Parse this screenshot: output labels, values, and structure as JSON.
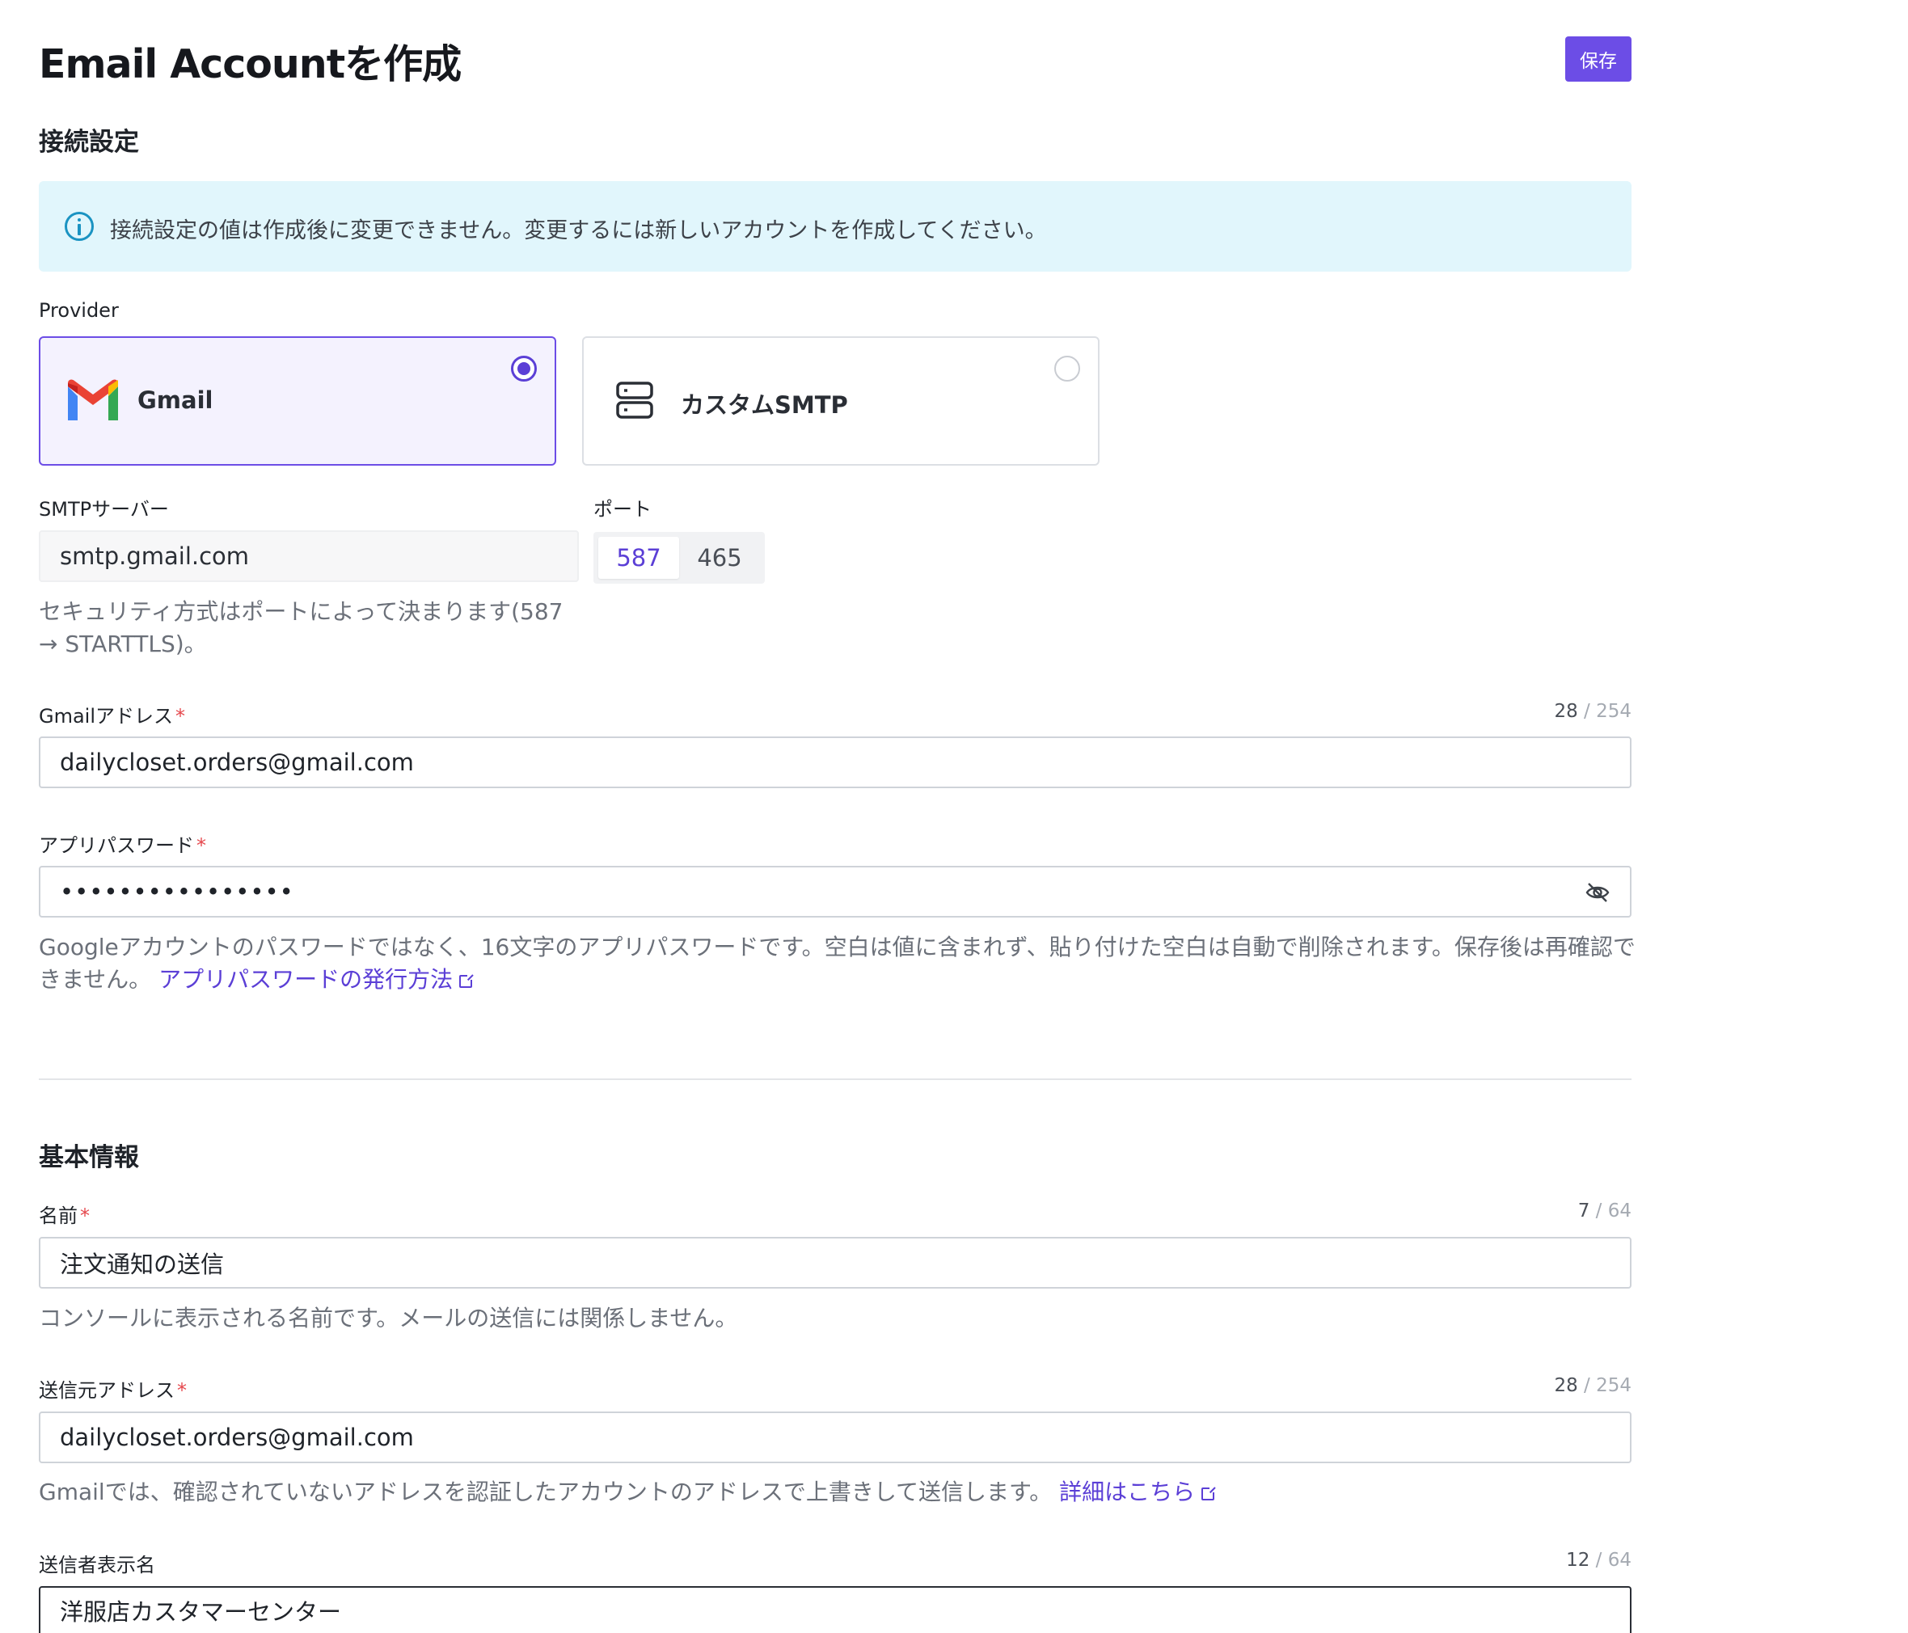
{
  "page": {
    "title": "Email Accountを作成",
    "save_label": "保存"
  },
  "connection": {
    "section_title": "接続設定",
    "info_text": "接続設定の値は作成後に変更できません。変更するには新しいアカウントを作成してください。",
    "provider_label": "Provider",
    "providers": [
      {
        "label": "Gmail",
        "selected": true
      },
      {
        "label": "カスタムSMTP",
        "selected": false
      }
    ],
    "smtp_server_label": "SMTPサーバー",
    "smtp_server_value": "smtp.gmail.com",
    "port_label": "ポート",
    "port_options": [
      "587",
      "465"
    ],
    "port_selected": "587",
    "security_help_line1": "セキュリティ方式はポートによって決まります(587",
    "security_help_line2": "→ STARTTLS)。",
    "gmail_address_label": "Gmailアドレス",
    "gmail_address_value": "dailycloset.orders@gmail.com",
    "gmail_address_count": "28",
    "gmail_address_max": "/ 254",
    "app_password_label": "アプリパスワード",
    "app_password_masked": "••••••••••••••••",
    "app_password_help_line1": "Googleアカウントのパスワードではなく、16文字のアプリパスワードです。空白は値に含まれず、貼り付けた空白は自動で削除されます。保存後は再確認で",
    "app_password_help_line2": "きません。",
    "app_password_link": "アプリパスワードの発行方法",
    "required_mark": "*"
  },
  "basic": {
    "section_title": "基本情報",
    "name_label": "名前",
    "name_value": "注文通知の送信",
    "name_count": "7",
    "name_max": "/ 64",
    "name_help": "コンソールに表示される名前です。メールの送信には関係しません。",
    "from_label": "送信元アドレス",
    "from_value": "dailycloset.orders@gmail.com",
    "from_count": "28",
    "from_max": "/ 254",
    "from_help": "Gmailでは、確認されていないアドレスを認証したアカウントのアドレスで上書きして送信します。",
    "from_link": "詳細はこちら",
    "sender_label": "送信者表示名",
    "sender_value": "洋服店カスタマーセンター",
    "sender_count": "12",
    "sender_max": "/ 64"
  },
  "colors": {
    "accent": "#6c4de6",
    "info_bg": "#e1f6fc",
    "info_icon": "#1a93c2",
    "required": "#e5484d"
  }
}
